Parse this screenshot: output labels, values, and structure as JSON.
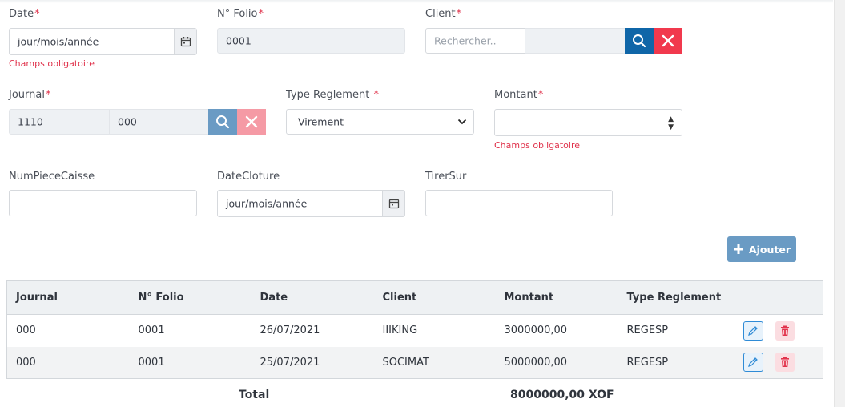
{
  "form": {
    "date": {
      "label": "Date",
      "required": "*",
      "placeholder": "jour/mois/année",
      "error": "Champs obligatoire"
    },
    "folio": {
      "label": "N° Folio",
      "required": "*",
      "value": "0001"
    },
    "client": {
      "label": "Client",
      "required": "*",
      "placeholder": "Rechercher..",
      "value": ""
    },
    "journal": {
      "label": "Journal",
      "required": "*",
      "code": "1110",
      "name": "000"
    },
    "type_reglement": {
      "label": "Type Reglement ",
      "required": "*",
      "selected": "Virement"
    },
    "montant": {
      "label": "Montant",
      "required": "*",
      "value": "",
      "error": "Champs obligatoire"
    },
    "num_piece_caisse": {
      "label": "NumPieceCaisse",
      "value": ""
    },
    "date_cloture": {
      "label": "DateCloture",
      "placeholder": "jour/mois/année"
    },
    "tirer_sur": {
      "label": "TirerSur",
      "value": ""
    }
  },
  "add_button": {
    "label": "Ajouter"
  },
  "table": {
    "columns": [
      "Journal",
      "N° Folio",
      "Date",
      "Client",
      "Montant",
      "Type Reglement"
    ],
    "rows": [
      [
        "000",
        "0001",
        "26/07/2021",
        "IIIKING",
        "3000000,00",
        "REGESP"
      ],
      [
        "000",
        "0001",
        "25/07/2021",
        "SOCIMAT",
        "5000000,00",
        "REGESP"
      ]
    ]
  },
  "totals": {
    "label": "Total",
    "value": "8000000,00 XOF"
  },
  "colors": {
    "primary": "#0f66a8",
    "danger": "#f1394d",
    "error_text": "#e0334c"
  },
  "icons": [
    "calendar-icon",
    "search-icon",
    "close-icon",
    "chevron-down-icon",
    "plus-icon",
    "pencil-icon",
    "trash-icon"
  ]
}
